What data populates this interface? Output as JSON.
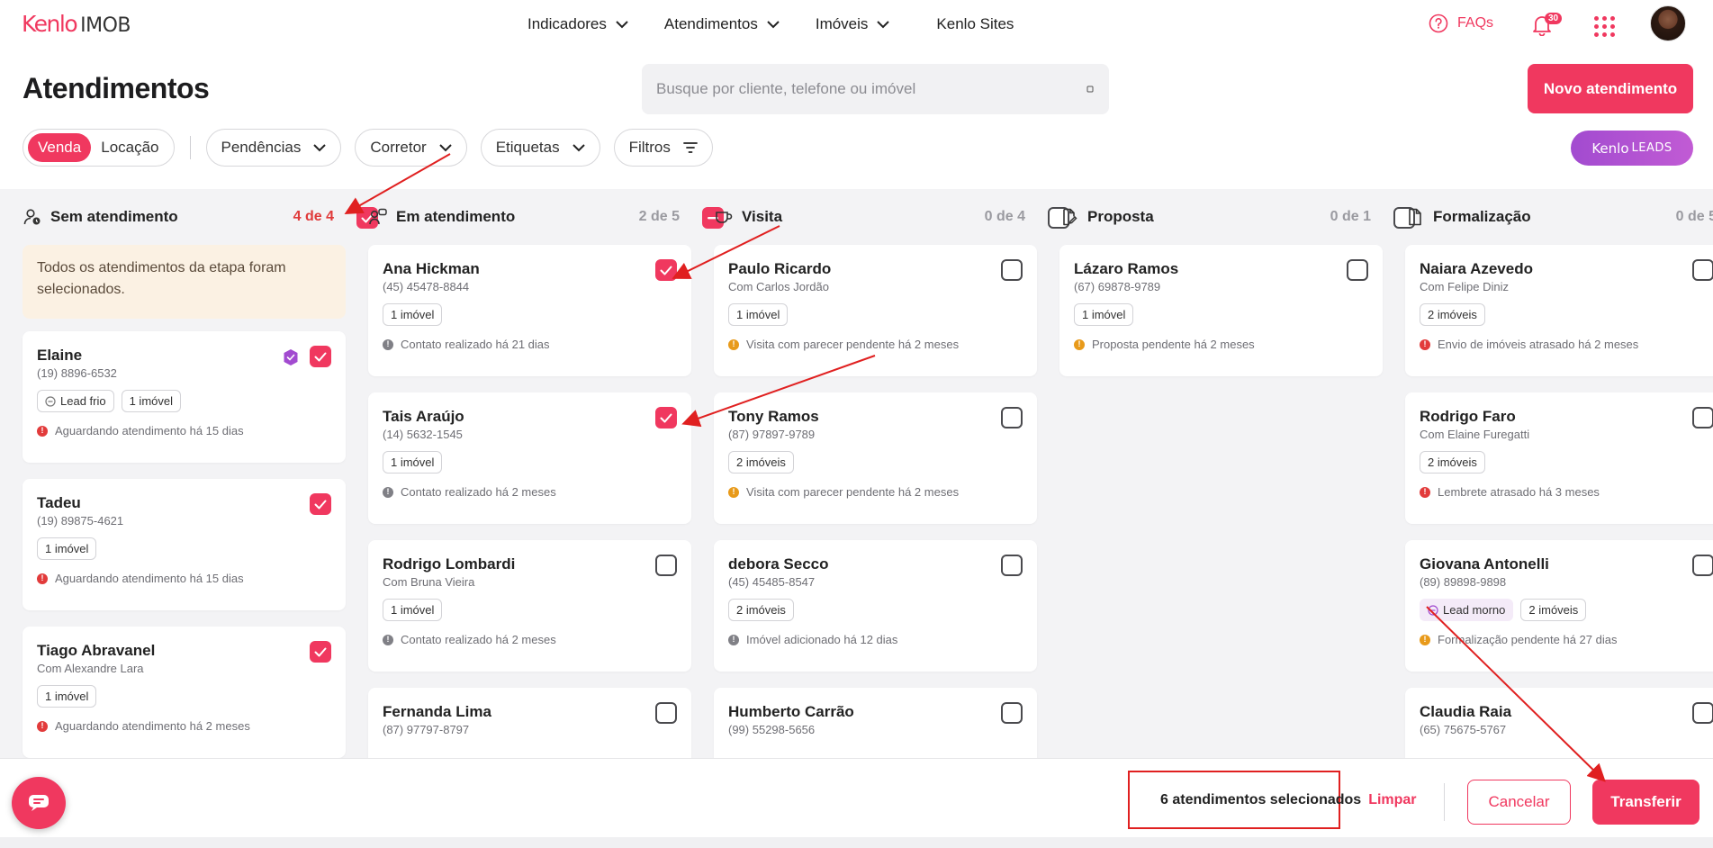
{
  "brand": {
    "logo_main": "Kenlo",
    "logo_sub": "IMOB",
    "leads_main": "Kenlo",
    "leads_sub": "LEADS"
  },
  "nav": {
    "items": [
      "Indicadores",
      "Atendimentos",
      "Imóveis",
      "Kenlo Sites"
    ],
    "faqs": "FAQs",
    "notifications": "30"
  },
  "page": {
    "title": "Atendimentos",
    "search_placeholder": "Busque por cliente, telefone ou imóvel",
    "new_button": "Novo atendimento"
  },
  "filters": {
    "segment": [
      "Venda",
      "Locação"
    ],
    "dropdowns": [
      "Pendências",
      "Corretor",
      "Etiquetas"
    ],
    "filters_label": "Filtros"
  },
  "columns": [
    {
      "title": "Sem atendimento",
      "count": "4 de 4",
      "header_state": "checked",
      "notice": "Todos os atendimentos da etapa foram selecionados.",
      "cards": [
        {
          "name": "Elaine",
          "sub": "(19) 8896-6532",
          "tags": [
            "Lead frio",
            "1 imóvel"
          ],
          "status": "Aguardando atendimento há 15 dias",
          "status_color": "red",
          "checked": true,
          "badge": "verified-shield"
        },
        {
          "name": "Tadeu",
          "sub": "(19) 89875-4621",
          "tags": [
            "1 imóvel"
          ],
          "status": "Aguardando atendimento há 15 dias",
          "status_color": "red",
          "checked": true
        },
        {
          "name": "Tiago Abravanel",
          "sub": "Com Alexandre Lara",
          "tags": [
            "1 imóvel"
          ],
          "status": "Aguardando atendimento há 2 meses",
          "status_color": "red",
          "checked": true
        }
      ]
    },
    {
      "title": "Em atendimento",
      "count": "2 de 5",
      "header_state": "partial",
      "cards": [
        {
          "name": "Ana Hickman",
          "sub": "(45) 45478-8844",
          "tags": [
            "1 imóvel"
          ],
          "status": "Contato realizado há 21 dias",
          "status_color": "gray",
          "checked": true
        },
        {
          "name": "Tais Araújo",
          "sub": "(14) 5632-1545",
          "tags": [
            "1 imóvel"
          ],
          "status": "Contato realizado há 2 meses",
          "status_color": "gray",
          "checked": true
        },
        {
          "name": "Rodrigo Lombardi",
          "sub": "Com Bruna Vieira",
          "tags": [
            "1 imóvel"
          ],
          "status": "Contato realizado há 2 meses",
          "status_color": "gray",
          "checked": false
        },
        {
          "name": "Fernanda Lima",
          "sub": "(87) 97797-8797",
          "tags": [],
          "status": "",
          "status_color": "gray",
          "checked": false
        }
      ]
    },
    {
      "title": "Visita",
      "count": "0 de 4",
      "header_state": "unchecked",
      "cards": [
        {
          "name": "Paulo Ricardo",
          "sub": "Com Carlos Jordão",
          "tags": [
            "1 imóvel"
          ],
          "status": "Visita com parecer pendente há 2 meses",
          "status_color": "orange",
          "checked": false
        },
        {
          "name": "Tony Ramos",
          "sub": "(87) 97897-9789",
          "tags": [
            "2 imóveis"
          ],
          "status": "Visita com parecer pendente há 2 meses",
          "status_color": "orange",
          "checked": false
        },
        {
          "name": "debora Secco",
          "sub": "(45) 45485-8547",
          "tags": [
            "2 imóveis"
          ],
          "status": "Imóvel adicionado há 12 dias",
          "status_color": "gray",
          "checked": false
        },
        {
          "name": "Humberto Carrão",
          "sub": "(99) 55298-5656",
          "tags": [],
          "status": "",
          "status_color": "gray",
          "checked": false
        }
      ]
    },
    {
      "title": "Proposta",
      "count": "0 de 1",
      "header_state": "unchecked",
      "cards": [
        {
          "name": "Lázaro Ramos",
          "sub": "(67) 69878-9789",
          "tags": [
            "1 imóvel"
          ],
          "status": "Proposta pendente há 2 meses",
          "status_color": "orange",
          "checked": false
        }
      ]
    },
    {
      "title": "Formalização",
      "count": "0 de 5",
      "header_state": "unchecked",
      "cards": [
        {
          "name": "Naiara Azevedo",
          "sub": "Com Felipe Diniz",
          "tags": [
            "2 imóveis"
          ],
          "status": "Envio de imóveis atrasado há 2 meses",
          "status_color": "red",
          "checked": false
        },
        {
          "name": "Rodrigo Faro",
          "sub": "Com Elaine Furegatti",
          "tags": [
            "2 imóveis"
          ],
          "status": "Lembrete atrasado há 3 meses",
          "status_color": "red",
          "checked": false
        },
        {
          "name": "Giovana Antonelli",
          "sub": "(89) 89898-9898",
          "tags": [
            "Lead morno",
            "2 imóveis"
          ],
          "status": "Formalização pendente há 27 dias",
          "status_color": "orange",
          "checked": false
        },
        {
          "name": "Claudia Raia",
          "sub": "(65) 75675-5767",
          "tags": [],
          "status": "",
          "status_color": "gray",
          "checked": false
        }
      ]
    }
  ],
  "selection": {
    "text": "6 atendimentos selecionados",
    "clear": "Limpar",
    "cancel": "Cancelar",
    "transfer": "Transferir"
  },
  "colors": {
    "accent": "#f0385f",
    "annotation": "#e02020",
    "lead_purple": "#a24bd0"
  }
}
